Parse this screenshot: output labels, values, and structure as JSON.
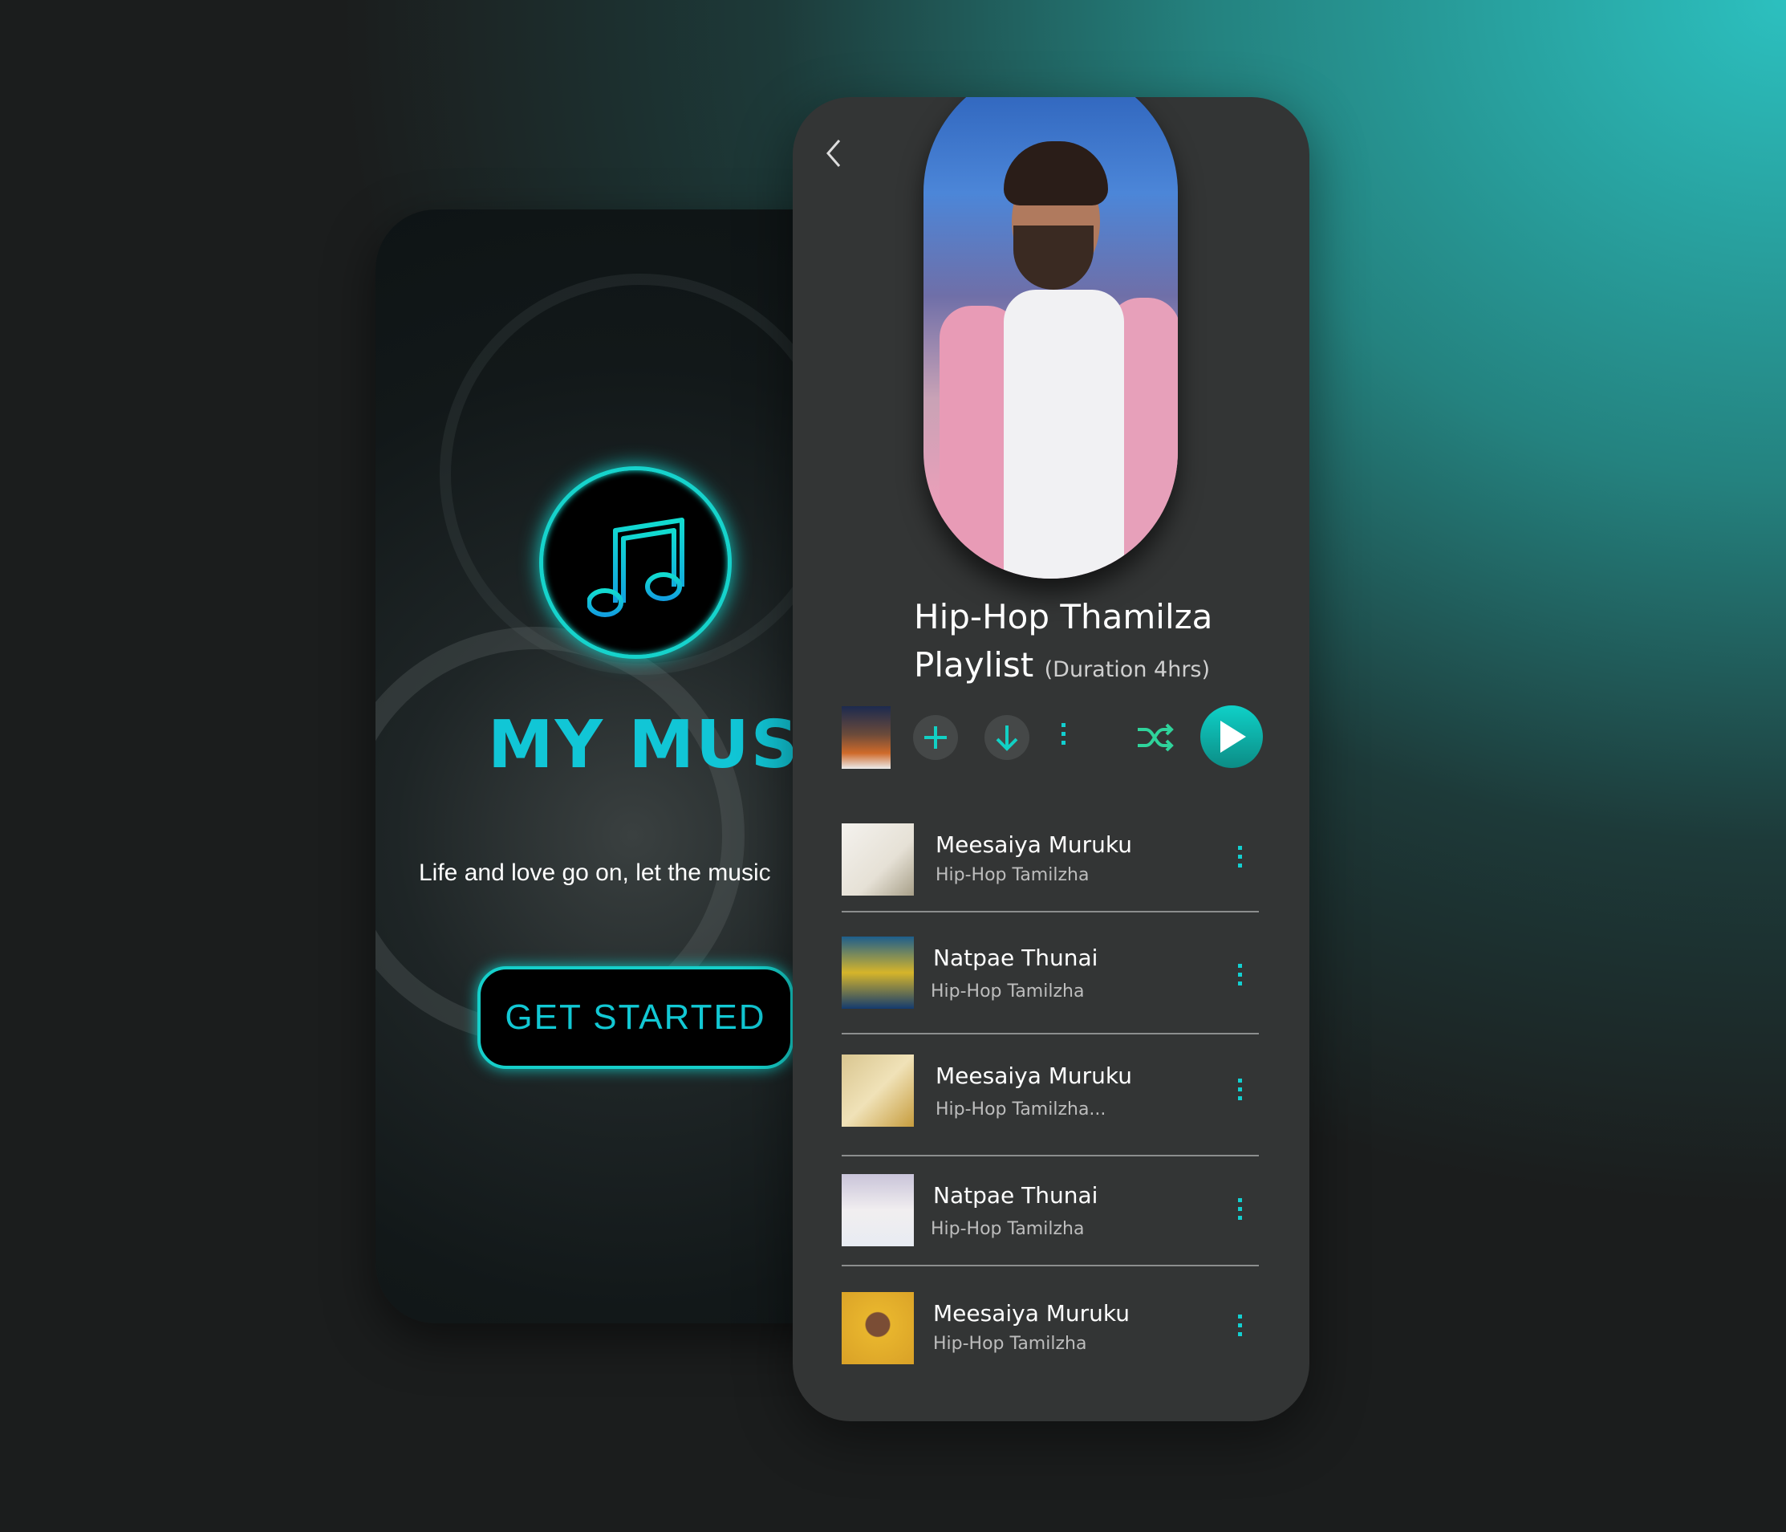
{
  "welcome": {
    "brand": "MY MUSIC",
    "tagline": "Life and love go on, let the music",
    "cta_label": "GET STARTED",
    "accent": "#12c8d4"
  },
  "playlist": {
    "title_line1": "Hip-Hop Thamilza",
    "title_line2": "Playlist",
    "duration": "(Duration 4hrs)",
    "controls": [
      "add-icon",
      "download-icon",
      "more-icon",
      "shuffle-icon",
      "play-icon"
    ],
    "accent": "#12cfd0",
    "tracks": [
      {
        "title": "Meesaiya Muruku",
        "artist": "Hip-Hop Tamilzha"
      },
      {
        "title": "Natpae Thunai",
        "artist": "Hip-Hop Tamilzha"
      },
      {
        "title": "Meesaiya Muruku",
        "artist": "Hip-Hop Tamilzha..."
      },
      {
        "title": "Natpae Thunai",
        "artist": "Hip-Hop Tamilzha"
      },
      {
        "title": "Meesaiya Muruku",
        "artist": "Hip-Hop Tamilzha"
      }
    ]
  }
}
